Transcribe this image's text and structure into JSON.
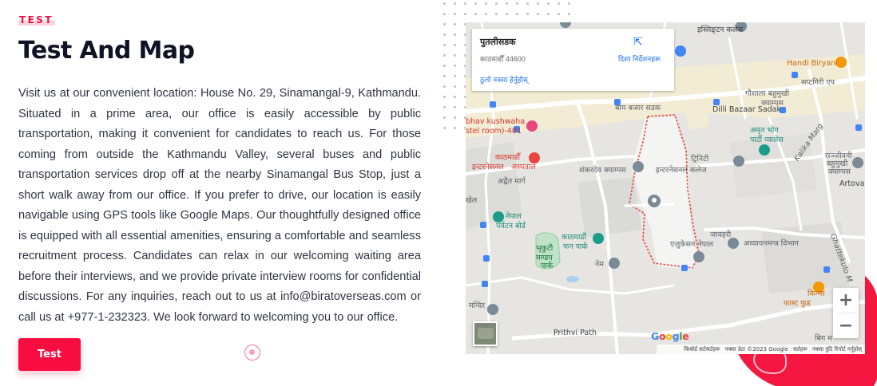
{
  "section": {
    "eyebrow": "TEST",
    "title": "Test And Map",
    "body": "Visit us at our convenient location: House No. 29, Sinamangal-9, Kathmandu. Situated in a prime area, our office is easily accessible by public transportation, making it convenient for candidates to reach us. For those coming from outside the Kathmandu Valley, several buses and public transportation services drop off at the nearby Sinamangal Bus Stop, just a short walk away from our office. If you prefer to drive, our location is easily navigable using GPS tools like Google Maps. Our thoughtfully designed office is equipped with all essential amenities, ensuring a comfortable and seamless recruitment process. Candidates can relax in our welcoming waiting area before their interviews, and we provide private interview rooms for confidential discussions. For any inquiries, reach out to us at info@biratoverseas.com or call us at +977-1-232323. We look forward to welcoming you to our office.",
    "button_label": "Test"
  },
  "map": {
    "place_name": "पुतलीसडक",
    "place_address": "काठमाडौँ 44600",
    "larger_map_link": "ठुलो नक्सा हेर्नुहोस्",
    "directions_label": "दिशा निर्देशनहरू",
    "zoom_in": "+",
    "zoom_out": "−",
    "google_logo": "Google",
    "attribution": {
      "shortcuts": "किबोर्ड सर्टकर्टहरू",
      "data": "नक्सा डेटा ©2023 Google",
      "terms": "सर्तहरू",
      "report": "नक्सा त्रुटि रिपोर्ट गर्नुहोस्"
    },
    "labels": {
      "college1": "इस्लिङ्टन कलेज",
      "handi_biryani": "Handi Biryani",
      "saptagiri": "सप्टगिरी एप",
      "bam_bazar": "बाम बजार सडक",
      "gaushala": "गौशाला बहुमुखी",
      "campus": "क्याम्पस",
      "dilli_bazaar": "Dilli Bazaar Sadak",
      "bhav_kushwaha": "bhav kushwaha",
      "hostel_room": "stel room)-401",
      "amrit_bhog": "अमृत भोग",
      "party_palace": "पार्टी प्यालेस",
      "kathmandu_hospital": "काठमाडौँ",
      "hospital2": "इन्टरनेसनल",
      "hospital3": "अस्पताल",
      "trinity": "ट्रिनिटी",
      "shankar_dev": "शंकरदेव क्याम्पस",
      "international_college": "इन्टरनेसनल कलेज",
      "kalika_marg": "Kalika Marg",
      "sanjeevani": "सञ्जीवनी",
      "bahumukhi": "बहुमुखी",
      "campus2": "क्याम्पस",
      "artova": "Artova",
      "adwait_marg": "अद्वैत मार्ग",
      "khel": "खेल",
      "nepal_tourism": "नेपाल",
      "tourism_board": "पर्यटन बोर्ड",
      "bhrikuti": "भृकुटी",
      "mandap": "मण्डप",
      "park": "पार्क",
      "kathmandu_fun": "काठमाडौं",
      "fun_park": "फन पार्क",
      "jawahari": "जावहरी",
      "education_nepal": "एजुकेसन नेपाल",
      "study_dept": "अध्यायनमन्त्र विभाग",
      "nema": "नेम",
      "mandir": "मन्दिर",
      "prithvi_path": "Prithvi Path",
      "kfc": "किन्ग्स",
      "fast_food": "फास्ट फुड",
      "big_mart": "बिग म",
      "ghattekulo": "Ghattekulo M"
    }
  }
}
